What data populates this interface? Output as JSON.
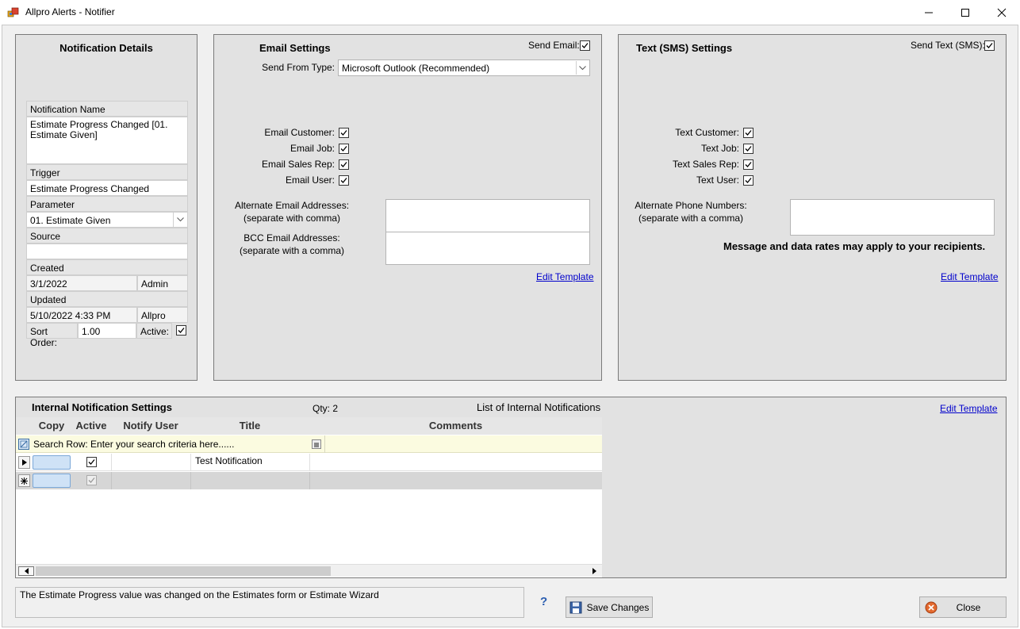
{
  "window": {
    "title": "Allpro Alerts - Notifier",
    "controls": {
      "minimize": "minimize-icon",
      "maximize": "maximize-icon",
      "close": "close-icon"
    }
  },
  "notification_details": {
    "title": "Notification Details",
    "name_label": "Notification Name",
    "name_value": "Estimate Progress Changed [01. Estimate Given]",
    "trigger_label": "Trigger",
    "trigger_value": "Estimate Progress Changed",
    "parameter_label": "Parameter",
    "parameter_value": "01. Estimate Given",
    "source_label": "Source",
    "source_value": "",
    "created_label": "Created",
    "created_date": "3/1/2022",
    "created_by": "Admin",
    "updated_label": "Updated",
    "updated_date": "5/10/2022 4:33 PM",
    "updated_by": "Allpro",
    "sort_order_label": "Sort Order:",
    "sort_order_value": "1.00",
    "active_label": "Active:",
    "active_checked": true
  },
  "email_settings": {
    "title": "Email Settings",
    "send_email_label": "Send Email:",
    "send_email_checked": true,
    "send_from_type_label": "Send From Type:",
    "send_from_type_value": "Microsoft Outlook (Recommended)",
    "email_customer_label": "Email Customer:",
    "email_job_label": "Email Job:",
    "email_sales_rep_label": "Email Sales Rep:",
    "email_user_label": "Email User:",
    "alt_emails_label_1": "Alternate Email Addresses:",
    "alt_emails_label_2": "(separate with comma)",
    "alt_emails_value": "",
    "bcc_label_1": "BCC Email Addresses:",
    "bcc_label_2": "(separate with a comma)",
    "bcc_value": "",
    "edit_template": "Edit Template"
  },
  "sms_settings": {
    "title": "Text (SMS) Settings",
    "send_text_label": "Send Text (SMS):",
    "send_text_checked": true,
    "text_customer_label": "Text Customer:",
    "text_job_label": "Text Job:",
    "text_sales_rep_label": "Text Sales Rep:",
    "text_user_label": "Text User:",
    "alt_phone_label_1": "Alternate Phone Numbers:",
    "alt_phone_label_2": "(separate with a comma)",
    "alt_phone_value": "",
    "rates_notice": "Message and data rates may apply to your recipients.",
    "edit_template": "Edit Template"
  },
  "internal": {
    "title": "Internal Notification Settings",
    "qty": "Qty: 2",
    "list_label": "List of Internal Notifications",
    "edit_template": "Edit Template",
    "columns": [
      "Copy",
      "Active",
      "Notify User",
      "Title",
      "Comments"
    ],
    "search_row_text": "Search Row: Enter your search criteria here......",
    "rows": [
      {
        "copy": "",
        "active": true,
        "notify_user": "",
        "title": "Test Notification",
        "comments": ""
      }
    ]
  },
  "footer": {
    "description": "The Estimate Progress value was changed on the Estimates form or Estimate Wizard",
    "help": "?",
    "save_label": "Save Changes",
    "close_label": "Close"
  }
}
